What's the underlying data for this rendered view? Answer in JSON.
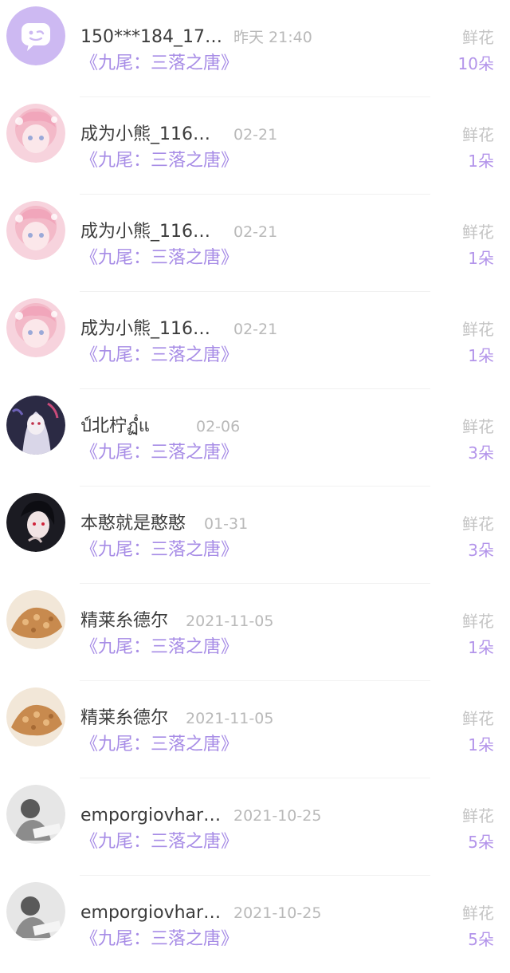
{
  "records": [
    {
      "name": "150***184_17…",
      "time": "昨天 21:40",
      "book": "《九尾：三落之唐》",
      "gift": "鲜花",
      "count": "10朵",
      "avatar": "default-chat-avatar"
    },
    {
      "name": "成为小熊_116…",
      "time": "02-21",
      "book": "《九尾：三落之唐》",
      "gift": "鲜花",
      "count": "1朵",
      "avatar": "pink-anime-avatar"
    },
    {
      "name": "成为小熊_116…",
      "time": "02-21",
      "book": "《九尾：三落之唐》",
      "gift": "鲜花",
      "count": "1朵",
      "avatar": "pink-anime-avatar"
    },
    {
      "name": "成为小熊_116…",
      "time": "02-21",
      "book": "《九尾：三落之唐》",
      "gift": "鲜花",
      "count": "1朵",
      "avatar": "pink-anime-avatar"
    },
    {
      "name": "ป์北柠ฏํํแ",
      "time": "02-06",
      "book": "《九尾：三落之唐》",
      "gift": "鲜花",
      "count": "3朵",
      "avatar": "dark-anime-avatar"
    },
    {
      "name": "本憨就是憨憨",
      "time": "01-31",
      "book": "《九尾：三落之唐》",
      "gift": "鲜花",
      "count": "3朵",
      "avatar": "dark-boy-avatar"
    },
    {
      "name": "精莱糸德尔",
      "time": "2021-11-05",
      "book": "《九尾：三落之唐》",
      "gift": "鲜花",
      "count": "1朵",
      "avatar": "bread-avatar"
    },
    {
      "name": "精莱糸德尔",
      "time": "2021-11-05",
      "book": "《九尾：三落之唐》",
      "gift": "鲜花",
      "count": "1朵",
      "avatar": "bread-avatar"
    },
    {
      "name": "emporgiovhar…",
      "time": "2021-10-25",
      "book": "《九尾：三落之唐》",
      "gift": "鲜花",
      "count": "5朵",
      "avatar": "grey-photo-avatar"
    },
    {
      "name": "emporgiovhar…",
      "time": "2021-10-25",
      "book": "《九尾：三落之唐》",
      "gift": "鲜花",
      "count": "5朵",
      "avatar": "grey-photo-avatar"
    }
  ],
  "colors": {
    "accent": "#a78ce6",
    "count": "#b394ea",
    "name": "#3c3c3c",
    "muted": "#b9b9b9",
    "default_avatar": "#cdb9f2"
  }
}
